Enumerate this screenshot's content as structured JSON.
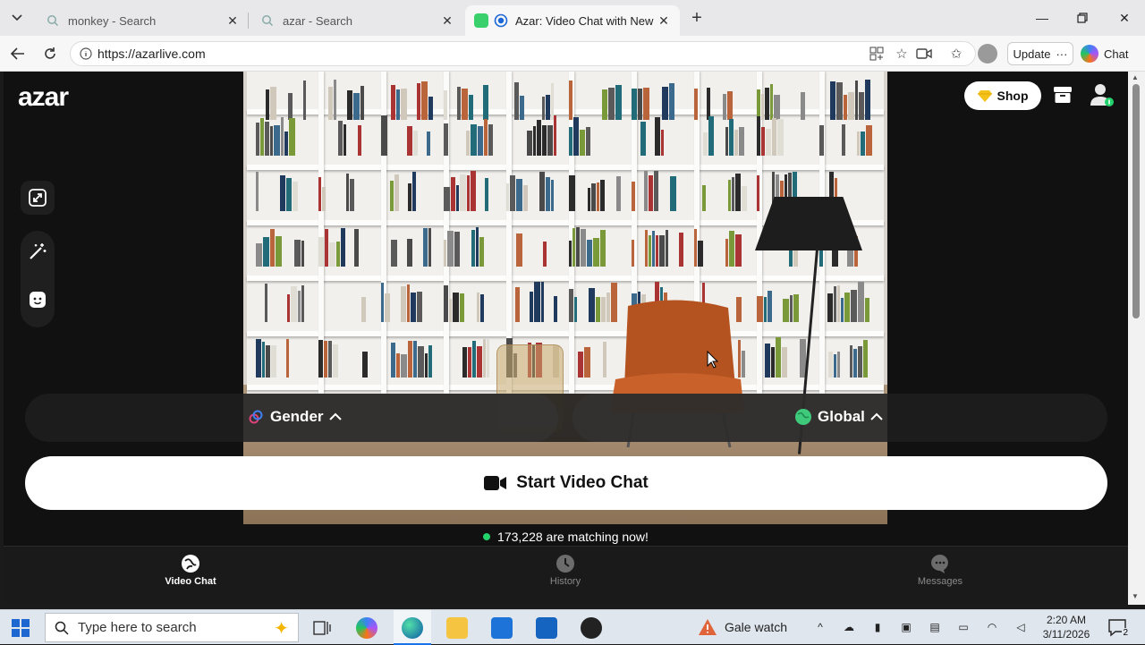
{
  "browser": {
    "tabs": [
      {
        "label": "monkey - Search",
        "icon": "search-icon",
        "active": false
      },
      {
        "label": "azar - Search",
        "icon": "search-icon",
        "active": false
      },
      {
        "label": "Azar: Video Chat with New Pe",
        "icon": "azar-favicon",
        "active": true
      }
    ],
    "url": "https://azarlive.com",
    "update_label": "Update",
    "chat_label": "Chat"
  },
  "app": {
    "logo": "azar",
    "shop_label": "Shop",
    "gender_label": "Gender",
    "global_label": "Global",
    "start_label": "Start Video Chat",
    "matching_text": "173,228 are matching now!",
    "nav": [
      {
        "label": "Video Chat",
        "icon": "globe-icon",
        "active": true
      },
      {
        "label": "History",
        "icon": "clock-icon",
        "active": false
      },
      {
        "label": "Messages",
        "icon": "chat-bubble-icon",
        "active": false
      }
    ],
    "accent_color": "#22d36b"
  },
  "taskbar": {
    "search_placeholder": "Type here to search",
    "gale_label": "Gale watch",
    "time": "2:20 AM",
    "date": "3/11/2026",
    "notification_count": "2"
  }
}
